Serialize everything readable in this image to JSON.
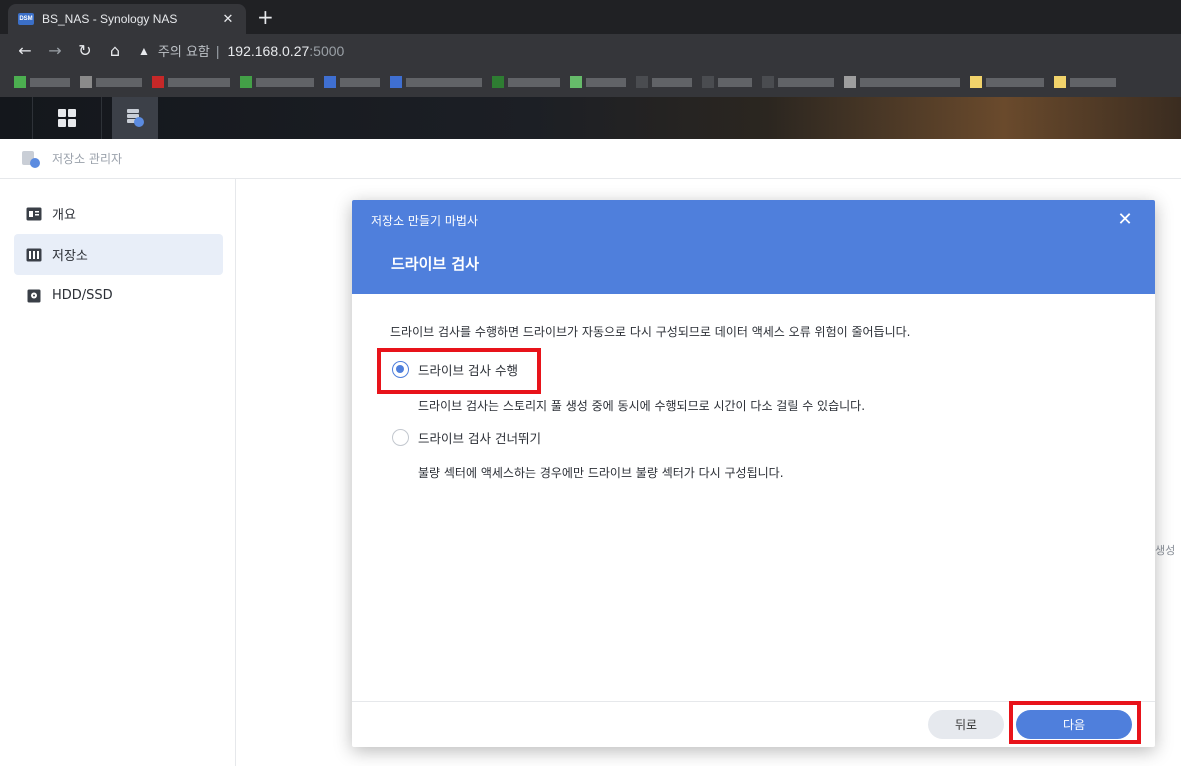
{
  "browser": {
    "tab_title": "BS_NAS - Synology NAS",
    "tab_favicon": "DSM",
    "tab_close": "✕",
    "new_tab": "+",
    "security_icon": "warning-triangle-icon",
    "security_text": "주의 요함",
    "url_host": "192.168.0.27",
    "url_port": ":5000"
  },
  "dsm": {
    "app_title": "저장소 관리자"
  },
  "sidebar": {
    "items": [
      {
        "label": "개요",
        "icon": "overview-icon",
        "active": false
      },
      {
        "label": "저장소",
        "icon": "storage-icon",
        "active": true
      },
      {
        "label": "HDD/SSD",
        "icon": "hdd-icon",
        "active": false
      }
    ]
  },
  "background_text": "생성",
  "dialog": {
    "title": "저장소 만들기 마법사",
    "close": "✕",
    "step_title": "드라이브 검사",
    "description": "드라이브 검사를 수행하면 드라이브가 자동으로 다시 구성되므로 데이터 액세스 오류 위험이 줄어듭니다.",
    "options": [
      {
        "label": "드라이브 검사 수행",
        "sub": "드라이브 검사는 스토리지 풀 생성 중에 동시에 수행되므로 시간이 다소 걸릴 수 있습니다.",
        "selected": true
      },
      {
        "label": "드라이브 검사 건너뛰기",
        "sub": "불량 섹터에 액세스하는 경우에만 드라이브 불량 섹터가 다시 구성됩니다.",
        "selected": false
      }
    ],
    "back_label": "뒤로",
    "next_label": "다음"
  },
  "colors": {
    "accent": "#4f7fdc",
    "highlight": "#e8131a"
  }
}
